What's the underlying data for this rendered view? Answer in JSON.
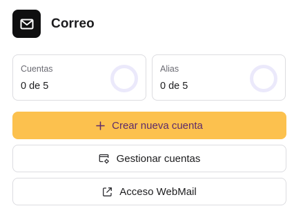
{
  "header": {
    "title": "Correo",
    "icon": "mail-icon"
  },
  "stats": [
    {
      "label": "Cuentas",
      "value": "0 de 5",
      "progress": 0
    },
    {
      "label": "Alias",
      "value": "0 de 5",
      "progress": 0
    }
  ],
  "actions": {
    "create": {
      "label": "Crear nueva cuenta",
      "icon": "plus-icon"
    },
    "manage": {
      "label": "Gestionar cuentas",
      "icon": "manage-accounts-icon"
    },
    "webmail": {
      "label": "Acceso WebMail",
      "icon": "external-link-icon"
    }
  },
  "colors": {
    "primary_button": "#fcc14e",
    "primary_text": "#5c2a6a",
    "logo_background": "#0f0f10",
    "ring": "#ebe9fb"
  }
}
